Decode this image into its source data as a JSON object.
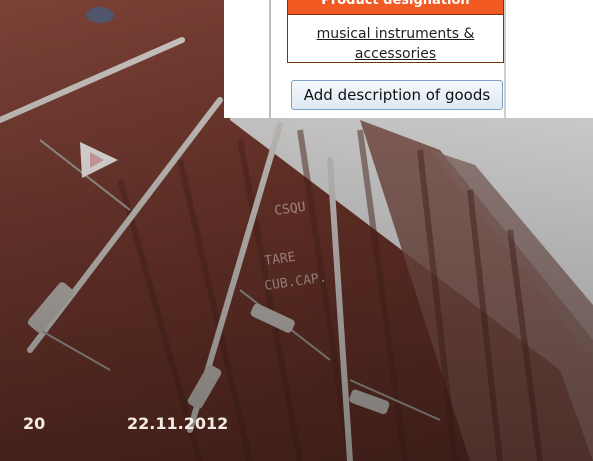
{
  "inset": {
    "header_label": "Product designation",
    "description_link": "musical instruments & accessories",
    "add_button_label": "Add description of goods"
  },
  "footer": {
    "page_number": "20",
    "date": "22.11.2012"
  }
}
